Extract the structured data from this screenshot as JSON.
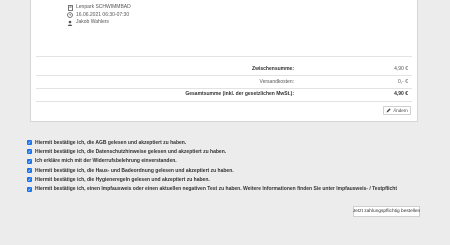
{
  "order": {
    "store": "Lenpark SCHWIMMBAD",
    "datetime": "16.06.2021 06:30-07:30",
    "person": "Jakob Wahlers"
  },
  "totals": {
    "subtotal_label": "Zwischensumme:",
    "subtotal_value": "4,90 €",
    "shipping_label": "Versandkosten:",
    "shipping_value": "0,- €",
    "grand_label": "Gesamtsumme (inkl. der gesetzlichen MwSt.):",
    "grand_value": "4,90 €"
  },
  "change_button": "Ändern",
  "checks": [
    "Hiermit bestätige ich, die AGB gelesen und akzeptiert zu haben.",
    "Hiermit bestätige ich, die Datenschutzhinweise gelesen und akzeptiert zu haben.",
    "Ich erkläre mich mit der Widerrufsbelehrung einverstanden.",
    "Hiermit bestätige ich, die Haus- und Badeordnung gelesen und akzeptiert zu haben.",
    "Hiermit bestätige ich, die Hygieneregeln gelesen und akzeptiert zu haben.",
    "Hiermit bestätige ich, einen Impfausweis oder einen aktuellen negativen Test zu haben. Weitere Informationen finden Sie unter Impfausweis- / Testpflicht"
  ],
  "order_button": "Jetzt zahlungspflichtig bestellen",
  "icons": {
    "store": "store-icon",
    "clock": "clock-icon",
    "person": "person-icon",
    "edit": "pencil-icon",
    "check": "checkbox-checked-icon"
  },
  "colors": {
    "checkbox": "#1a73e8",
    "background": "#ececec",
    "card": "#ffffff"
  }
}
